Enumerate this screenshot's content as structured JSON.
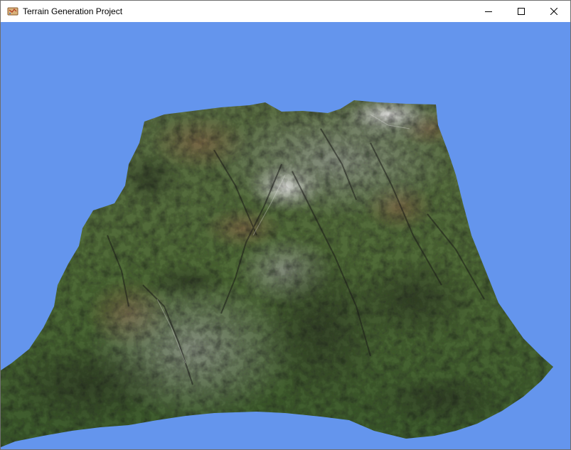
{
  "window": {
    "title": "Terrain Generation Project",
    "icon": "map-scroll-icon",
    "controls": [
      "minimize-icon",
      "maximize-icon",
      "close-icon"
    ]
  },
  "viewport": {
    "background_color": "#6495ed",
    "content": "3d-terrain-mesh",
    "colors": {
      "grass": "#4f6e38",
      "rock": "#8e948a",
      "soil": "#8a6048",
      "snow": "#d3d3d1",
      "shadow": "#1c1c1a"
    }
  }
}
